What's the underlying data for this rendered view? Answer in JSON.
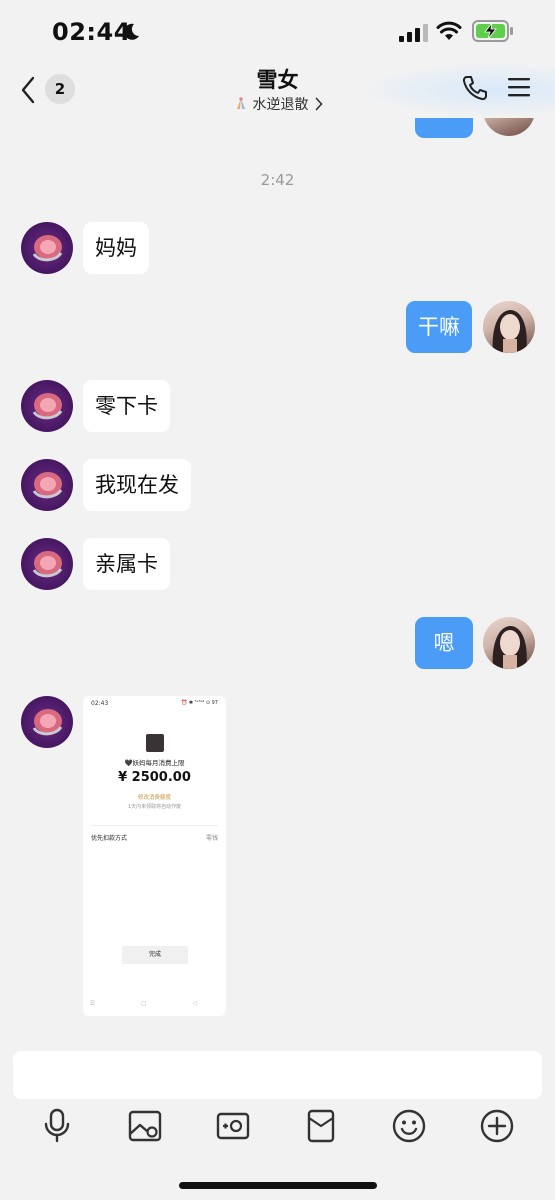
{
  "status_bar": {
    "time": "02:44"
  },
  "header": {
    "back_badge": "2",
    "title": "雪女",
    "subtitle": "水逆退散"
  },
  "chat": {
    "timestamp": "2:42",
    "messages": [
      {
        "side": "incoming",
        "text": "妈妈"
      },
      {
        "side": "outgoing",
        "text": "干嘛"
      },
      {
        "side": "incoming",
        "text": "零下卡"
      },
      {
        "side": "incoming",
        "text": "我现在发"
      },
      {
        "side": "incoming",
        "text": "亲属卡"
      },
      {
        "side": "outgoing",
        "text": "嗯"
      }
    ],
    "image_message": {
      "time": "02:43",
      "status_text": "⏰ ✱ ᵀᵉ⁵ᵃˡˡ ⊙ 97",
      "title": "🖤妖妈每月消费上限",
      "amount": "¥ 2500.00",
      "link": "修改消费额度",
      "note": "1天内未领取将自动作废",
      "method_label": "优先扣款方式",
      "method_value": "零钱",
      "done_button": "完成",
      "nav_glyphs": "☰ ▢ ◁"
    }
  },
  "colors": {
    "background": "#f2f2f2",
    "outgoing_bubble": "#4a9cf7",
    "incoming_bubble": "#ffffff"
  },
  "toolbar": {
    "icons": [
      "microphone-icon",
      "image-icon",
      "camera-icon",
      "red-packet-icon",
      "emoji-icon",
      "plus-icon"
    ]
  }
}
